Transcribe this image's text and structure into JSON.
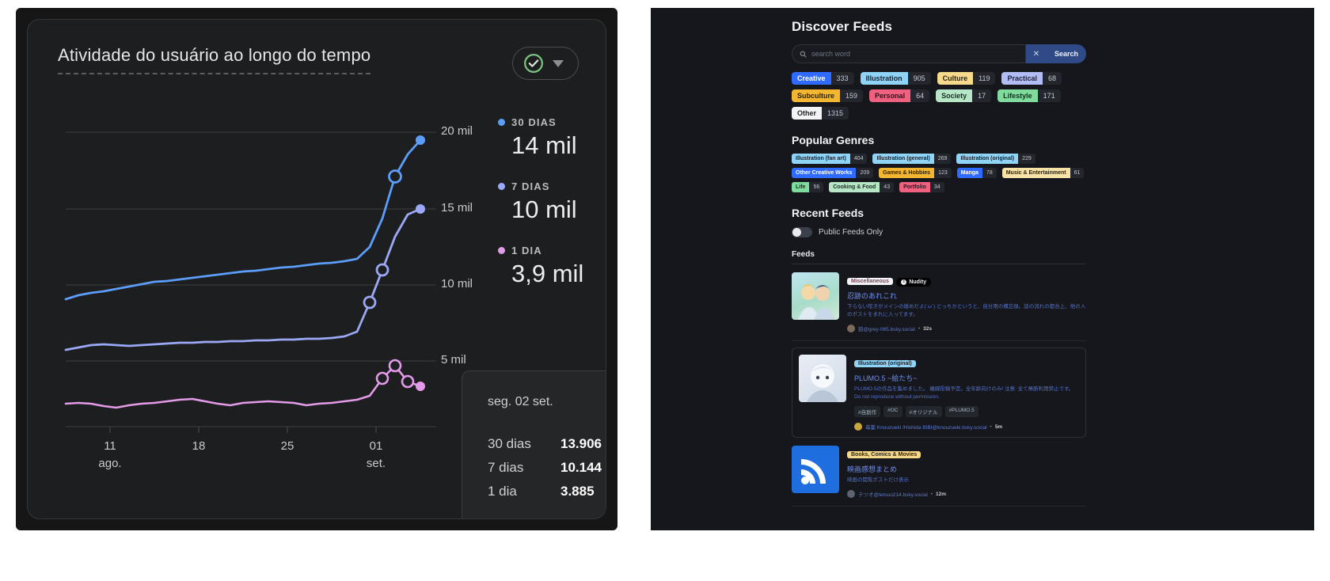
{
  "chart_panel": {
    "title": "Atividade do usuário ao longo do tempo",
    "range_selector": {
      "check_icon": "check-circle-icon",
      "caret_icon": "chevron-down-icon",
      "accent": "#7bc47f"
    },
    "legend": [
      {
        "name": "30 DIAS",
        "value": "14 mil",
        "color": "#5b9df9"
      },
      {
        "name": "7 DIAS",
        "value": "10 mil",
        "color": "#9aa8f5"
      },
      {
        "name": "1 DIA",
        "value": "3,9 mil",
        "color": "#e39ae8"
      }
    ],
    "tooltip": {
      "date": "seg. 02 set.",
      "rows": [
        {
          "key": "30 dias",
          "value": "13.906"
        },
        {
          "key": "7 dias",
          "value": "10.144"
        },
        {
          "key": "1 dia",
          "value": "3.885"
        }
      ]
    }
  },
  "chart_data": {
    "type": "line",
    "title": "Atividade do usuário ao longo do tempo",
    "xlabel": "",
    "ylabel": "",
    "ylim": [
      0,
      22000
    ],
    "yticks": [
      5000,
      10000,
      15000,
      20000
    ],
    "ytick_labels": [
      "5 mil",
      "10 mil",
      "15 mil",
      "20 mil"
    ],
    "grid": true,
    "legend_position": "right",
    "xticks": [
      "11",
      "18",
      "25",
      "01"
    ],
    "xtick_sublabels": [
      "ago.",
      "",
      "",
      "set."
    ],
    "x": [
      "05",
      "06",
      "07",
      "08",
      "09",
      "10",
      "11",
      "12",
      "13",
      "14",
      "15",
      "16",
      "17",
      "18",
      "19",
      "20",
      "21",
      "22",
      "23",
      "24",
      "25",
      "26",
      "27",
      "28",
      "29",
      "30",
      "31",
      "01",
      "02"
    ],
    "series": [
      {
        "name": "30 dias",
        "color": "#5b9df9",
        "values": [
          7100,
          7250,
          7350,
          7400,
          7500,
          7600,
          7700,
          7800,
          7850,
          7900,
          7980,
          8050,
          8100,
          8150,
          8200,
          8260,
          8320,
          8380,
          8420,
          8470,
          8520,
          8570,
          8620,
          8700,
          9200,
          10400,
          12200,
          13100,
          13906
        ]
      },
      {
        "name": "7 dias",
        "color": "#9aa8f5",
        "values": [
          4600,
          4650,
          4700,
          4720,
          4700,
          4690,
          4700,
          4720,
          4740,
          4750,
          4760,
          4770,
          4780,
          4790,
          4800,
          4810,
          4820,
          4830,
          4840,
          4850,
          4860,
          4870,
          4900,
          5000,
          5600,
          6900,
          8400,
          9500,
          10144
        ]
      },
      {
        "name": "1 dia",
        "color": "#e39ae8",
        "values": [
          3550,
          3560,
          3540,
          3490,
          3460,
          3500,
          3540,
          3560,
          3590,
          3620,
          3640,
          3600,
          3540,
          3520,
          3560,
          3580,
          3590,
          3580,
          3560,
          3520,
          3540,
          3560,
          3590,
          3620,
          3700,
          4050,
          4300,
          3980,
          3885
        ]
      }
    ],
    "highlight_points": [
      {
        "series": "30 dias",
        "x": "31",
        "value": 12200
      },
      {
        "series": "30 dias",
        "x": "02",
        "value": 13906
      },
      {
        "series": "7 dias",
        "x": "30",
        "value": 6900
      },
      {
        "series": "7 dias",
        "x": "31",
        "value": 8400
      },
      {
        "series": "7 dias",
        "x": "02",
        "value": 10144
      },
      {
        "series": "1 dia",
        "x": "30",
        "value": 4050
      },
      {
        "series": "1 dia",
        "x": "31",
        "value": 4300
      },
      {
        "series": "1 dia",
        "x": "02",
        "value": 3885
      }
    ]
  },
  "feeds_panel": {
    "title": "Discover Feeds",
    "search": {
      "placeholder": "search word",
      "value": "",
      "icon": "search-icon",
      "clear_label": "✕",
      "search_label": "Search"
    },
    "categories": [
      {
        "label": "Creative",
        "count": "333",
        "color": "#2f6bff",
        "text": "#ffffff"
      },
      {
        "label": "Illustration",
        "count": "905",
        "color": "#8fd4f7",
        "text": "#18202b"
      },
      {
        "label": "Culture",
        "count": "119",
        "color": "#f7d98c",
        "text": "#2b2410"
      },
      {
        "label": "Practical",
        "count": "68",
        "color": "#b3bdf5",
        "text": "#1b2038"
      },
      {
        "label": "Subculture",
        "count": "159",
        "color": "#f2b630",
        "text": "#2b2208"
      },
      {
        "label": "Personal",
        "count": "64",
        "color": "#f0607f",
        "text": "#33121c"
      },
      {
        "label": "Society",
        "count": "17",
        "color": "#b6e6c6",
        "text": "#173023"
      },
      {
        "label": "Lifestyle",
        "count": "171",
        "color": "#7fdc9c",
        "text": "#123120"
      },
      {
        "label": "Other",
        "count": "1315",
        "color": "#f3f4f6",
        "text": "#23262c"
      }
    ],
    "genres_title": "Popular Genres",
    "genres": [
      {
        "label": "Illustration (fan art)",
        "count": "404",
        "color": "#8fd4f7",
        "text": "#18202b"
      },
      {
        "label": "Illustration (general)",
        "count": "269",
        "color": "#8fd4f7",
        "text": "#18202b"
      },
      {
        "label": "Illustration (original)",
        "count": "229",
        "color": "#8fd4f7",
        "text": "#18202b"
      },
      {
        "label": "Other Creative Works",
        "count": "209",
        "color": "#2f6bff",
        "text": "#ffffff"
      },
      {
        "label": "Games & Hobbies",
        "count": "123",
        "color": "#f2b630",
        "text": "#2b2208"
      },
      {
        "label": "Manga",
        "count": "78",
        "color": "#2f6bff",
        "text": "#ffffff"
      },
      {
        "label": "Music & Entertainment",
        "count": "61",
        "color": "#f7e2a8",
        "text": "#2b2410"
      },
      {
        "label": "Life",
        "count": "56",
        "color": "#7fdc9c",
        "text": "#123120"
      },
      {
        "label": "Cooking & Food",
        "count": "43",
        "color": "#b6e6c6",
        "text": "#173023"
      },
      {
        "label": "Portfolio",
        "count": "34",
        "color": "#f0607f",
        "text": "#33121c"
      }
    ],
    "recent_title": "Recent Feeds",
    "public_only": {
      "label": "Public Feeds Only",
      "on": false
    },
    "feeds_subheader": "Feeds",
    "feeds": [
      {
        "badge": {
          "label": "Miscellaneous",
          "color": "#f3f4f6",
          "text": "#8a3b5c"
        },
        "warning": "Nudity",
        "title": "忍跡のあれこれ",
        "desc": "下らない呟きがメインの緩めだよ(´ω`) どっちかというと、自分用の備忘録。話の流れの都合上、他の人のポストをまれに入ってます。",
        "tags": [],
        "author": "狼@grey-065.bsky.social",
        "time": "32s",
        "avatar": "#7c6a58",
        "thumb": "anime-duo-thumbnail"
      },
      {
        "badge": {
          "label": "Illustration (original)",
          "color": "#8fd4f7",
          "text": "#18202b"
        },
        "warning": "",
        "title": "PLUMO.5 ~絵たち~",
        "desc": "PLUMO.5の作品を集めました。 離線投稿予定。全年齢向けのみ! 注意: 全て無断利用禁止です。 Do not reproduce without permission.",
        "tags": [
          "#自創作",
          "#OC",
          "#オリジナル",
          "#PLUMO.5"
        ],
        "author": "苺薬 Knouzueki /Hishida BIBI@knouzueki.bsky.social",
        "time": "5m",
        "avatar": "#c8a83a",
        "thumb": "manga-portrait-thumbnail"
      },
      {
        "badge": {
          "label": "Books, Comics & Movies",
          "color": "#f7d98c",
          "text": "#2b2410"
        },
        "warning": "",
        "title": "映画感想まとめ",
        "desc": "映画の閲覧ポストだけ表示",
        "tags": [],
        "author": "テツオ@tetsuo214.bsky.social",
        "time": "12m",
        "avatar": "#5c6470",
        "thumb": "rss-feed-thumbnail"
      }
    ]
  }
}
